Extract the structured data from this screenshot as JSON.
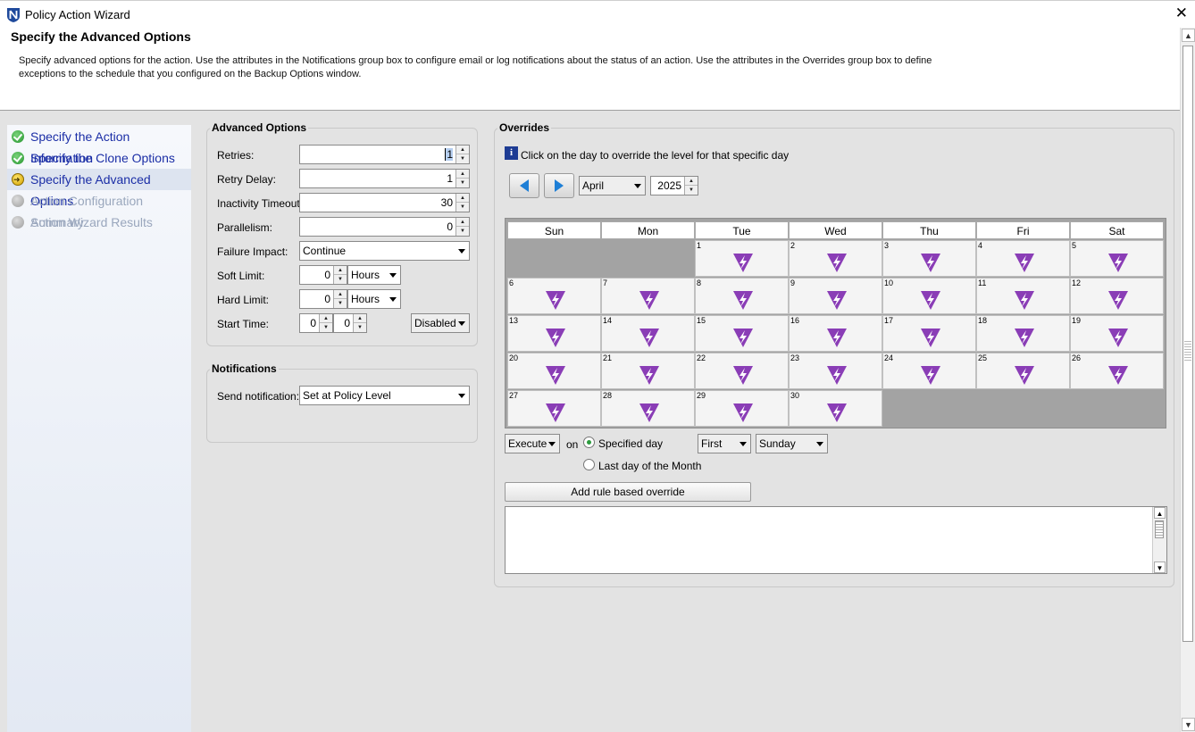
{
  "window": {
    "title": "Policy Action Wizard",
    "close_glyph": "✕"
  },
  "header": {
    "title": "Specify the Advanced Options",
    "description": "Specify advanced options for the action. Use the attributes in the Notifications group box to configure email or log notifications about the status of an action. Use the attributes in the Overrides group box to define exceptions to the schedule that you configured on the Backup Options window."
  },
  "steps": [
    {
      "label": "Specify the Action Information",
      "status": "done"
    },
    {
      "label": "Specify the Clone Options",
      "status": "done"
    },
    {
      "label": "Specify the Advanced Options",
      "status": "current"
    },
    {
      "label": "Action Configuration Summary",
      "status": "pending"
    },
    {
      "label": "Action Wizard Results",
      "status": "pending"
    }
  ],
  "advanced": {
    "title": "Advanced Options",
    "retries_label": "Retries:",
    "retries_value": "1",
    "retry_delay_label": "Retry Delay:",
    "retry_delay_value": "1",
    "inactivity_label": "Inactivity Timeout:",
    "inactivity_value": "30",
    "parallelism_label": "Parallelism:",
    "parallelism_value": "0",
    "failure_label": "Failure Impact:",
    "failure_value": "Continue",
    "soft_label": "Soft Limit:",
    "soft_value": "0",
    "soft_unit": "Hours",
    "hard_label": "Hard Limit:",
    "hard_value": "0",
    "hard_unit": "Hours",
    "start_label": "Start Time:",
    "start_hour": "0",
    "start_min": "0",
    "start_state": "Disabled"
  },
  "notifications": {
    "title": "Notifications",
    "send_label": "Send notification:",
    "send_value": "Set at Policy Level"
  },
  "overrides": {
    "title": "Overrides",
    "info": "Click on the day to override the level for that specific day",
    "month": "April",
    "year": "2025",
    "weekdays": [
      "Sun",
      "Mon",
      "Tue",
      "Wed",
      "Thu",
      "Fri",
      "Sat"
    ],
    "days": [
      "1",
      "2",
      "3",
      "4",
      "5",
      "6",
      "7",
      "8",
      "9",
      "10",
      "11",
      "12",
      "13",
      "14",
      "15",
      "16",
      "17",
      "18",
      "19",
      "20",
      "21",
      "22",
      "23",
      "24",
      "25",
      "26",
      "27",
      "28",
      "29",
      "30"
    ],
    "day_icon": "level-override-icon",
    "day_icon_color": "#8a3db6",
    "action": "Execute",
    "on_label": "on",
    "specified_day": "Specified day",
    "last_day": "Last day of the Month",
    "ordinal": "First",
    "weekday": "Sunday",
    "add_rule_label": "Add rule based override"
  }
}
